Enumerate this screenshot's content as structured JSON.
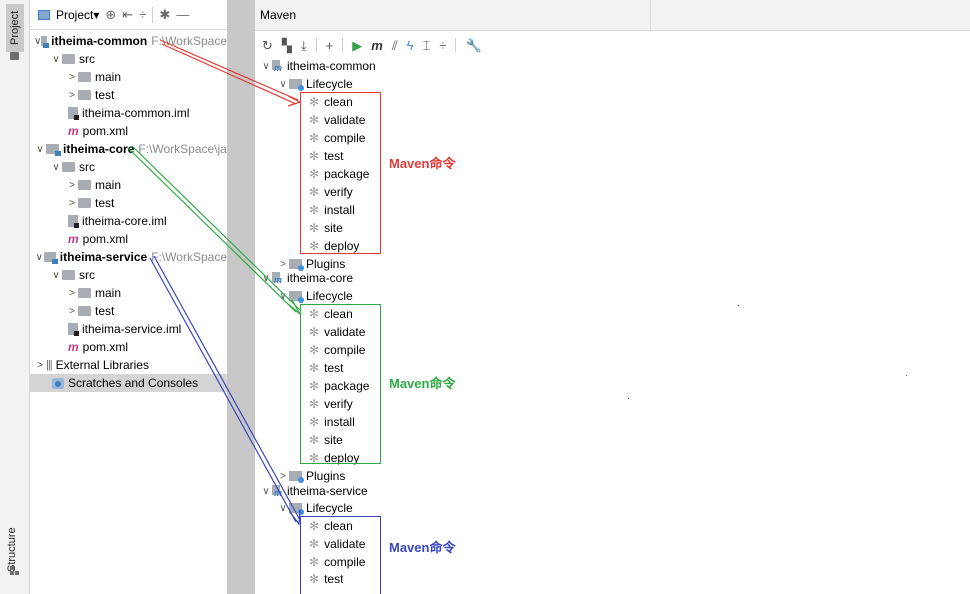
{
  "side_tabs": {
    "project": "Project",
    "structure": "Structure"
  },
  "project_panel": {
    "title": "Project▾",
    "toolbar_icons": [
      "target-icon",
      "collapse-icon",
      "expand-icon",
      "gear-icon",
      "minimize-icon"
    ],
    "tree": [
      {
        "label": "itheima-common",
        "path": "F:\\WorkSpace",
        "type": "module"
      },
      {
        "label": "src"
      },
      {
        "label": "main"
      },
      {
        "label": "test"
      },
      {
        "label": "itheima-common.iml"
      },
      {
        "label": "pom.xml"
      },
      {
        "label": "itheima-core",
        "path": "F:\\WorkSpace\\ja",
        "type": "module"
      },
      {
        "label": "src"
      },
      {
        "label": "main"
      },
      {
        "label": "test"
      },
      {
        "label": "itheima-core.iml"
      },
      {
        "label": "pom.xml"
      },
      {
        "label": "itheima-service",
        "path": "F:\\WorkSpace",
        "type": "module"
      },
      {
        "label": "src"
      },
      {
        "label": "main"
      },
      {
        "label": "test"
      },
      {
        "label": "itheima-service.iml"
      },
      {
        "label": "pom.xml"
      },
      {
        "label": "External Libraries"
      },
      {
        "label": "Scratches and Consoles"
      }
    ]
  },
  "maven_panel": {
    "title": "Maven",
    "toolbar_icons": [
      "refresh-icon",
      "generate-sources-icon",
      "download-icon",
      "add-icon",
      "run-icon",
      "maven-goal-icon",
      "toggle-offline-icon",
      "skip-tests-icon",
      "show-dependencies-icon",
      "collapse-all-icon",
      "settings-wrench-icon"
    ],
    "projects": [
      {
        "name": "itheima-common",
        "lifecycle_label": "Lifecycle",
        "plugins_label": "Plugins",
        "goals": [
          "clean",
          "validate",
          "compile",
          "test",
          "package",
          "verify",
          "install",
          "site",
          "deploy"
        ],
        "annotation": "Maven命令",
        "color": "#e53935"
      },
      {
        "name": "itheima-core",
        "lifecycle_label": "Lifecycle",
        "plugins_label": "Plugins",
        "goals": [
          "clean",
          "validate",
          "compile",
          "test",
          "package",
          "verify",
          "install",
          "site",
          "deploy"
        ],
        "annotation": "Maven命令",
        "color": "#2eaa44"
      },
      {
        "name": "itheima-service",
        "lifecycle_label": "Lifecycle",
        "goals": [
          "clean",
          "validate",
          "compile",
          "test"
        ],
        "annotation": "Maven命令",
        "color": "#3a45c0"
      }
    ]
  }
}
